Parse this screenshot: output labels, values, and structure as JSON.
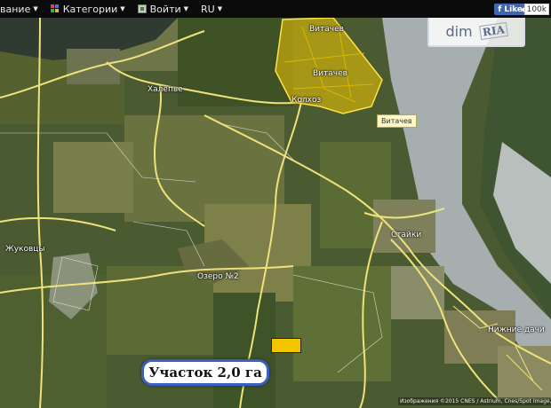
{
  "topbar": {
    "items": [
      {
        "label": "вание",
        "has_caret": true
      },
      {
        "label": "Категории",
        "has_caret": true,
        "icon": "categories-icon"
      },
      {
        "label": "Войти",
        "has_caret": true,
        "icon": "login-icon"
      },
      {
        "label": "RU",
        "has_caret": true
      }
    ],
    "fb_like_label": "Like",
    "fb_like_count": "100k"
  },
  "watermark": {
    "left": "dim",
    "right": "RIA"
  },
  "places": {
    "vitachev_top": "Витачев",
    "vitachev_inner": "Витачев",
    "kolkhoz": "Колхоз",
    "khalepye": "Халепье",
    "zhukovtsy": "Жуковцы",
    "staiki": "Стайки",
    "ozero": "Озеро №2",
    "nizhnie_dachi": "Нижние дачи",
    "vitachev_popup": "Витачев"
  },
  "plot": {
    "callout_text": "Участок 2,0 га",
    "marker_color": "#f2c500"
  },
  "attribution": "Изображения ©2015 CNES / Astrium, Cnes/Spot Image, Digital",
  "colors": {
    "road": "#efe27a",
    "highlight": "#f2c800",
    "river": "#a7aeb0",
    "callout_border": "#3b5fc0"
  }
}
